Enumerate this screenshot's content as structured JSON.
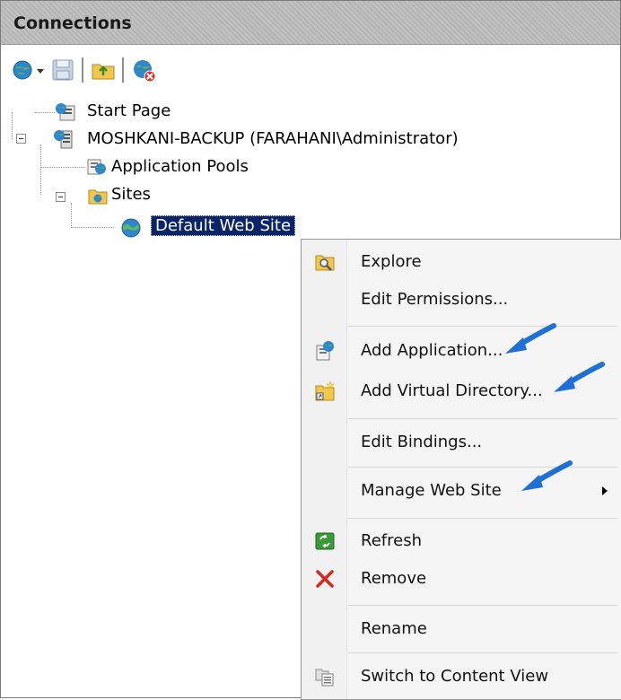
{
  "header": {
    "title": "Connections"
  },
  "toolbar": {
    "icons": [
      "connect-globe-icon",
      "save-icon",
      "folder-up-icon",
      "disconnect-icon"
    ]
  },
  "tree": {
    "start_page": "Start Page",
    "server": "MOSHKANI-BACKUP (FARAHANI\\Administrator)",
    "app_pools": "Application Pools",
    "sites": "Sites",
    "default_site": "Default Web Site"
  },
  "context_menu": {
    "explore": "Explore",
    "edit_permissions": "Edit Permissions...",
    "add_application": "Add Application...",
    "add_virtual_directory": "Add Virtual Directory...",
    "edit_bindings": "Edit Bindings...",
    "manage_web_site": "Manage Web Site",
    "refresh": "Refresh",
    "remove": "Remove",
    "rename": "Rename",
    "switch_content_view": "Switch to Content View"
  },
  "colors": {
    "selection": "#0a246a",
    "annotation_arrow": "#1e6fd6",
    "header": "#bcbcbc"
  }
}
